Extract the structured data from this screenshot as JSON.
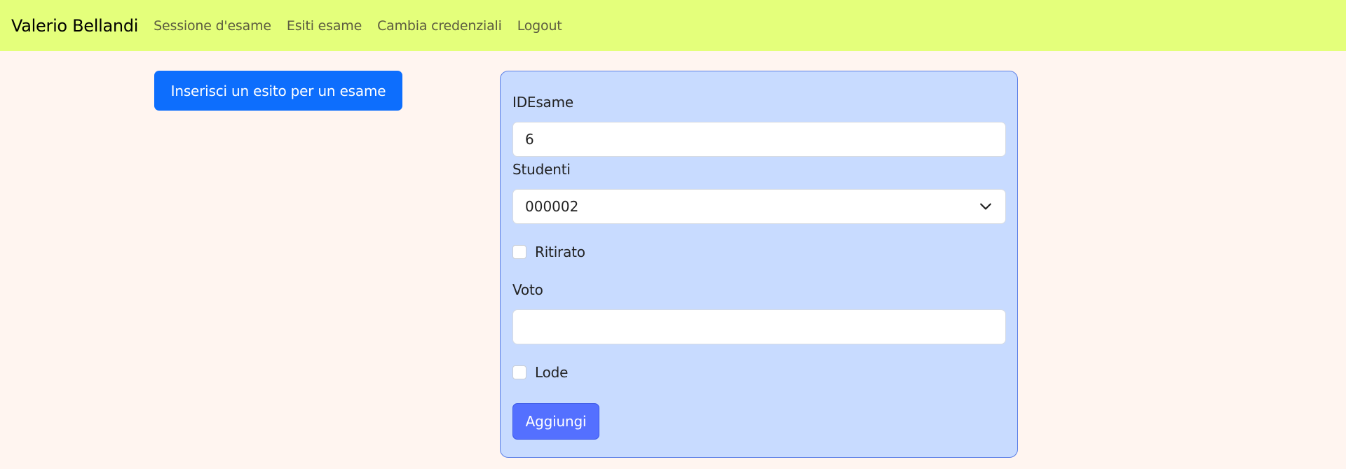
{
  "navbar": {
    "brand": "Valerio Bellandi",
    "links": [
      {
        "label": "Sessione d'esame"
      },
      {
        "label": "Esiti esame"
      },
      {
        "label": "Cambia credenziali"
      },
      {
        "label": "Logout"
      }
    ]
  },
  "sidebar": {
    "button_label": "Inserisci un esito per un esame"
  },
  "form": {
    "idesame_label": "IDEsame",
    "idesame_value": "6",
    "studenti_label": "Studenti",
    "studenti_selected": "000002",
    "ritirato_label": "Ritirato",
    "ritirato_checked": false,
    "voto_label": "Voto",
    "voto_value": "",
    "lode_label": "Lode",
    "lode_checked": false,
    "submit_label": "Aggiungi"
  },
  "colors": {
    "navbar_bg": "#e4ff7b",
    "page_bg": "#fff5f0",
    "primary_button": "#0d6efd",
    "form_bg": "#c8dbff",
    "submit_button": "#5470ff"
  },
  "icons": {
    "select_arrow": "chevron-down-icon"
  }
}
